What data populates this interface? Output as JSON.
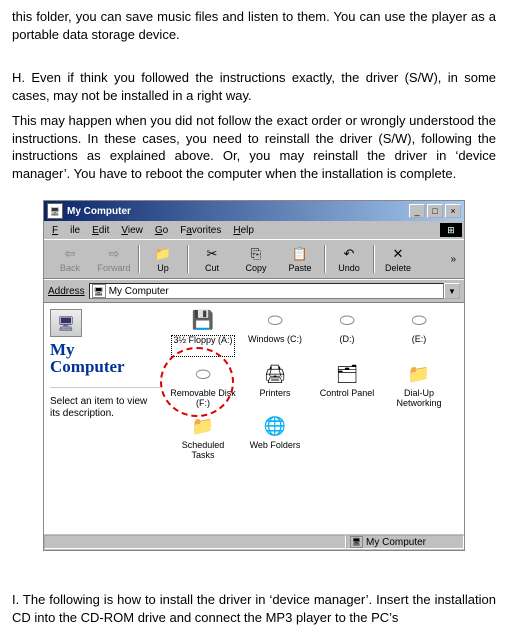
{
  "paragraphs": {
    "top": "this folder, you can save music files and listen to them. You can use the player as a portable data storage device.",
    "h_intro": "H.    Even if think you followed the instructions exactly, the driver (S/W), in some cases, may not be installed in a right way.",
    "h_body": "This may happen when you did not follow the exact order or wrongly understood the instructions. In these cases, you need to reinstall the driver (S/W), following the instructions as explained above. Or, you may reinstall the driver in ‘device manager’. You have to reboot the computer when the installation is complete.",
    "i_body": "I.    The following is how to install the driver in ‘device manager’. Insert the installation CD into the CD-ROM drive and connect the MP3 player to the PC’s"
  },
  "window": {
    "title": "My Computer",
    "minimize": "_",
    "maximize": "□",
    "close": "×"
  },
  "menu": {
    "file": "File",
    "edit": "Edit",
    "view": "View",
    "go": "Go",
    "favorites": "Favorites",
    "help": "Help"
  },
  "toolbar": {
    "back": "Back",
    "forward": "Forward",
    "up": "Up",
    "cut": "Cut",
    "copy": "Copy",
    "paste": "Paste",
    "undo": "Undo",
    "delete": "Delete",
    "more": "»"
  },
  "address": {
    "label": "Address",
    "value": "My Computer"
  },
  "leftpane": {
    "title_line1": "My",
    "title_line2": "Computer",
    "desc": "Select an item to view its description."
  },
  "icons": {
    "floppy": "3½ Floppy (A:)",
    "c": "Windows (C:)",
    "d": "(D:)",
    "e": "(E:)",
    "removable": "Removable Disk (F:)",
    "printers": "Printers",
    "control": "Control Panel",
    "dialup": "Dial-Up Networking",
    "scheduled": "Scheduled Tasks",
    "webfolders": "Web Folders"
  },
  "statusbar": {
    "right": "My Computer"
  }
}
